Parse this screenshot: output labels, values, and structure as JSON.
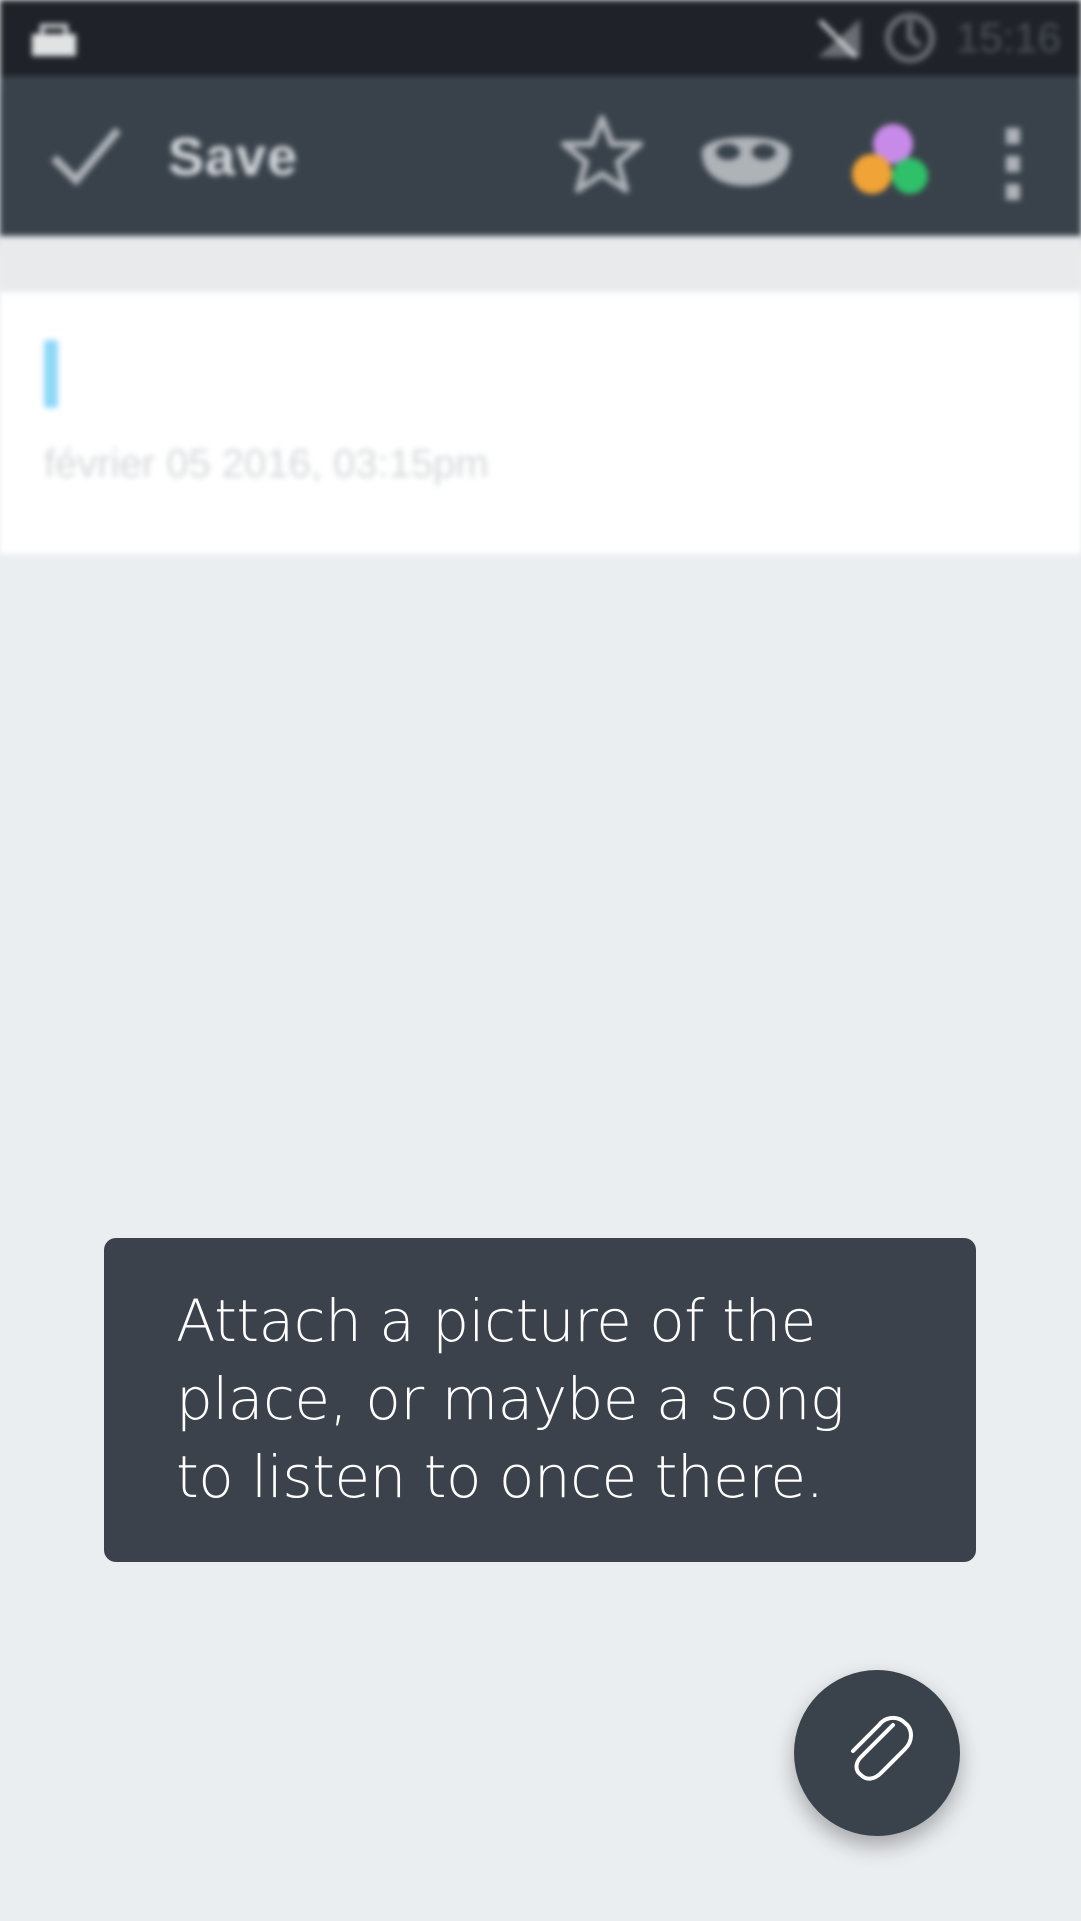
{
  "status_bar": {
    "time": "15:16",
    "icons": [
      "keyboard-icon",
      "no-signal-icon",
      "sync-icon"
    ]
  },
  "toolbar": {
    "save_label": "Save",
    "icons": [
      "check-icon",
      "star-icon",
      "mask-icon",
      "color-palette-icon",
      "more-vert-icon"
    ]
  },
  "note": {
    "date": "février 05 2016, 03:15pm"
  },
  "tooltip": {
    "text": "Attach a picture of the place, or maybe a song to listen to once there."
  },
  "fab": {
    "icon": "paperclip-icon"
  },
  "colors": {
    "status_bar": "#1f2329",
    "toolbar": "#39424b",
    "background": "#ebeef1",
    "tooltip": "#3c424b",
    "fab": "#3a424b",
    "cursor": "#8fd8f8"
  }
}
